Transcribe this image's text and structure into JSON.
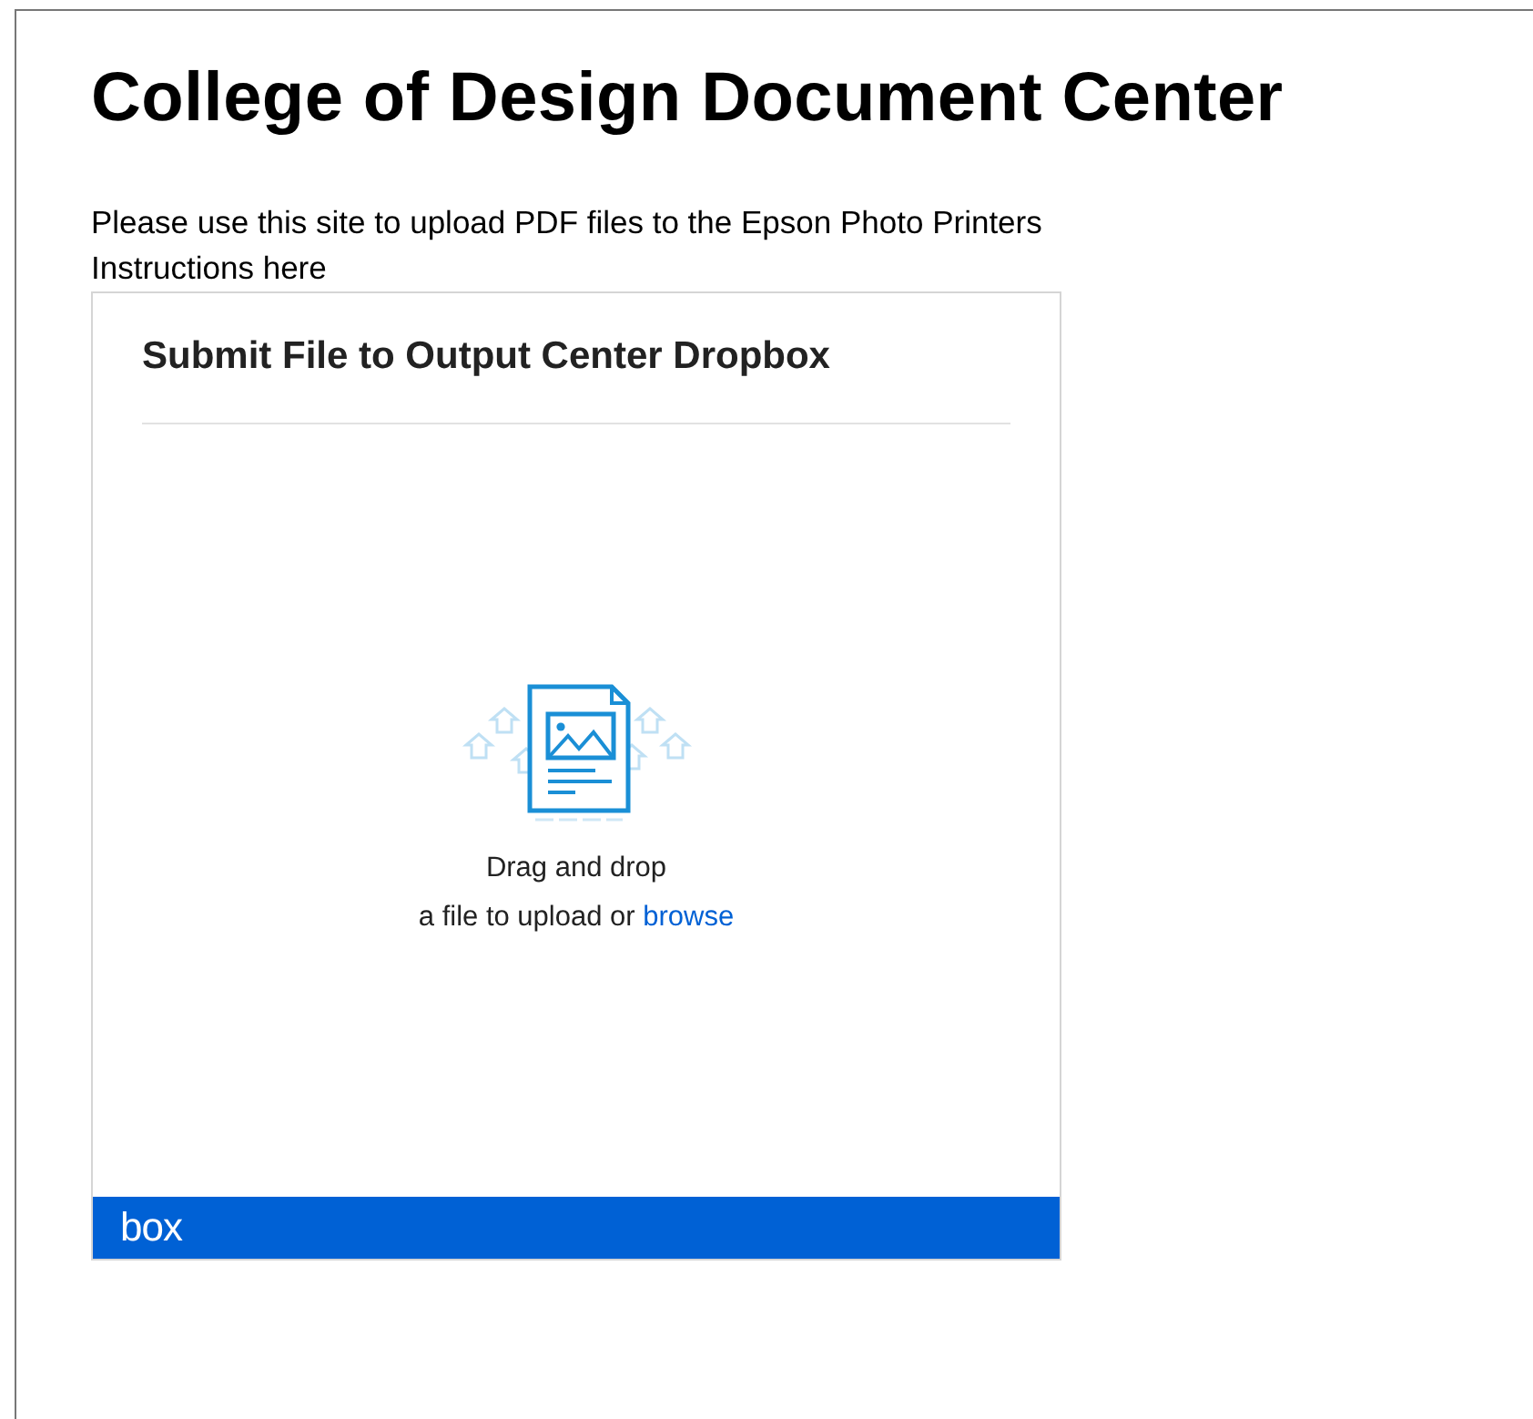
{
  "heading": "College of Design Document Center",
  "intro_lines": [
    "Please use this site to upload PDF files to the Epson Photo Printers",
    "Instructions here"
  ],
  "widget": {
    "title": "Submit File to Output Center Dropbox",
    "drop_line_1": "Drag and drop",
    "drop_line_2": "a file to upload or ",
    "browse_link": "browse",
    "footer_logo": "box"
  }
}
